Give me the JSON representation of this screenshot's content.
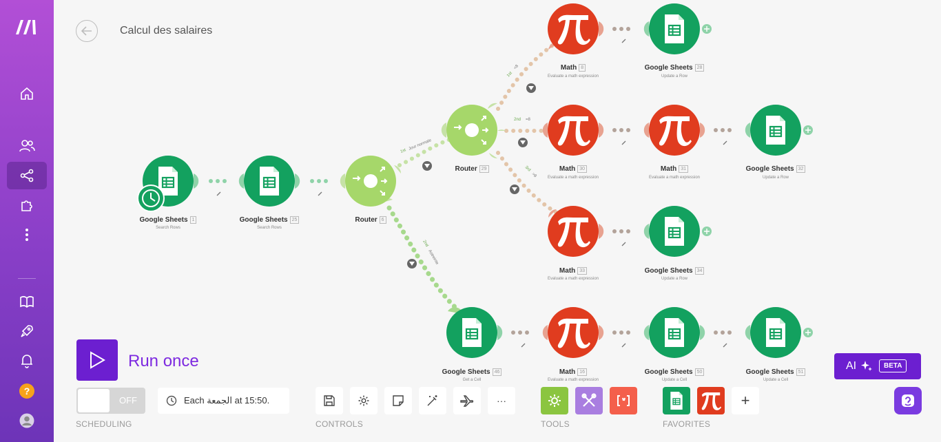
{
  "scenario": {
    "title": "Calcul des salaires"
  },
  "colors": {
    "sheets": "#13a15f",
    "router": "#a6d76a",
    "math": "#e03c1f",
    "accent": "#6c1fd0"
  },
  "nodes": [
    {
      "name": "Google Sheets",
      "num": "1",
      "sub": "Search Rows"
    },
    {
      "name": "Google Sheets",
      "num": "25",
      "sub": "Search Rows"
    },
    {
      "name": "Router",
      "num": "6",
      "sub": ""
    },
    {
      "name": "Router",
      "num": "29",
      "sub": ""
    },
    {
      "name": "Math",
      "num": "8",
      "sub": "Evaluate a math expression"
    },
    {
      "name": "Google Sheets",
      "num": "28",
      "sub": "Update a Row"
    },
    {
      "name": "Math",
      "num": "30",
      "sub": "Evaluate a math expression"
    },
    {
      "name": "Math",
      "num": "31",
      "sub": "Evaluate a math expression"
    },
    {
      "name": "Google Sheets",
      "num": "32",
      "sub": "Update a Row"
    },
    {
      "name": "Math",
      "num": "33",
      "sub": "Evaluate a math expression"
    },
    {
      "name": "Google Sheets",
      "num": "34",
      "sub": "Update a Row"
    },
    {
      "name": "Google Sheets",
      "num": "46",
      "sub": "Get a Cell"
    },
    {
      "name": "Math",
      "num": "16",
      "sub": "Evaluate a math expression"
    },
    {
      "name": "Google Sheets",
      "num": "50",
      "sub": "Update a Cell"
    },
    {
      "name": "Google Sheets",
      "num": "51",
      "sub": "Update a Cell"
    }
  ],
  "routes": [
    {
      "order": "1st",
      "label": "Jour normale"
    },
    {
      "order": "2nd",
      "label": "Astreinte"
    },
    {
      "order": "1st",
      "label": "<8"
    },
    {
      "order": "2nd",
      "label": "=8"
    },
    {
      "order": "3rd",
      "label": ">8"
    }
  ],
  "run": {
    "label": "Run once"
  },
  "scheduling": {
    "toggle": "OFF",
    "text": "Each الجمعة at 15:50.",
    "section": "SCHEDULING"
  },
  "controls": {
    "section": "CONTROLS",
    "more": "···"
  },
  "tools": {
    "section": "TOOLS",
    "items": [
      "tools-icon",
      "flow-control-icon",
      "text-parser-icon"
    ]
  },
  "favorites": {
    "section": "FAVORITES",
    "items": [
      "google-sheets-icon",
      "math-icon"
    ],
    "add": "+"
  },
  "ai": {
    "label": "AI",
    "badge": "BETA"
  },
  "sidebar": {
    "items": [
      "make-logo",
      "home-icon",
      "team-icon",
      "scenarios-icon",
      "apps-icon",
      "more-icon",
      "docs-icon",
      "rocket-icon",
      "notifications-icon",
      "help-icon",
      "user-avatar"
    ],
    "help_glyph": "?"
  }
}
